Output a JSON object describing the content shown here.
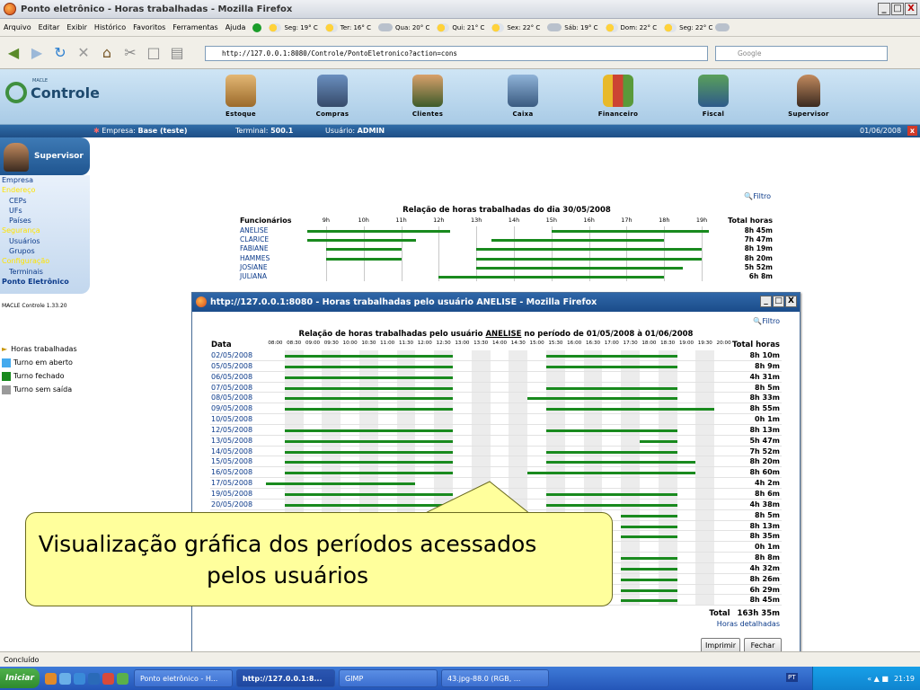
{
  "browser": {
    "title": "Ponto eletrônico - Horas trabalhadas - Mozilla Firefox",
    "window_buttons": [
      "_",
      "□",
      "X"
    ],
    "menu": [
      "Arquivo",
      "Editar",
      "Exibir",
      "Histórico",
      "Favoritos",
      "Ferramentas",
      "Ajuda"
    ],
    "weather": [
      "Seg: 19° C",
      "Ter: 16° C",
      "Qua: 20° C",
      "Qui: 21° C",
      "Sex: 22° C",
      "Sáb: 19° C",
      "Dom: 22° C",
      "Seg: 22° C"
    ],
    "url": "http://127.0.0.1:8080/Controle/PontoEletronico?action=cons",
    "search_placeholder": "Google",
    "status": "Concluído"
  },
  "app": {
    "logo_small": "MACLE",
    "logo": "Controle",
    "modules": [
      "Estoque",
      "Compras",
      "Clientes",
      "Caixa",
      "Financeiro",
      "Fiscal",
      "Supervisor"
    ],
    "status_strip": {
      "empresa_label": "Empresa:",
      "empresa": "Base (teste)",
      "terminal_label": "Terminal:",
      "terminal": "500.1",
      "usuario_label": "Usuário:",
      "usuario": "ADMIN",
      "date": "01/06/2008"
    }
  },
  "sidebar": {
    "user_box": "Supervisor",
    "nav": [
      {
        "label": "Empresa",
        "style": "h"
      },
      {
        "label": "Endereço",
        "style": "y"
      },
      {
        "label": "CEPs",
        "style": "s"
      },
      {
        "label": "UFs",
        "style": "s"
      },
      {
        "label": "Países",
        "style": "s"
      },
      {
        "label": "Segurança",
        "style": "y"
      },
      {
        "label": "Usuários",
        "style": "s"
      },
      {
        "label": "Grupos",
        "style": "s"
      },
      {
        "label": "Configuração",
        "style": "y"
      },
      {
        "label": "Terminais",
        "style": "s"
      },
      {
        "label": "Ponto Eletrônico",
        "style": "b"
      }
    ],
    "version": "MACLE Controle 1.33.20",
    "legend": [
      {
        "label": "Horas trabalhadas",
        "color": ""
      },
      {
        "label": "Turno em aberto",
        "color": "#44aaee"
      },
      {
        "label": "Turno fechado",
        "color": "#198a1e"
      },
      {
        "label": "Turno sem saída",
        "color": "#9a9a9a"
      }
    ]
  },
  "bg_report": {
    "filtro": "Filtro",
    "title": "Relação de horas trabalhadas do dia 30/05/2008",
    "col_name": "Funcionários",
    "col_total": "Total horas",
    "hours": [
      "9h",
      "10h",
      "11h",
      "12h",
      "13h",
      "14h",
      "15h",
      "16h",
      "17h",
      "18h",
      "19h"
    ],
    "rows": [
      {
        "name": "ANELISE",
        "total": "8h 45m"
      },
      {
        "name": "CLARICE",
        "total": "7h 47m"
      },
      {
        "name": "FABIANE",
        "total": "8h 19m"
      },
      {
        "name": "HAMMES",
        "total": "8h 20m"
      },
      {
        "name": "JOSIANE",
        "total": "5h 52m"
      },
      {
        "name": "JULIANA",
        "total": "6h 8m"
      }
    ]
  },
  "popup": {
    "title": "http://127.0.0.1:8080 - Horas trabalhadas pelo usuário ANELISE - Mozilla Firefox",
    "filtro": "Filtro",
    "chart_title_pre": "Relação de horas trabalhadas pelo usuário ",
    "chart_title_user": "ANELISE",
    "chart_title_post": " no período de 01/05/2008 à 01/06/2008",
    "col_date": "Data",
    "col_total": "Total horas",
    "times": [
      "08:00",
      "08:30",
      "09:00",
      "09:30",
      "10:00",
      "10:30",
      "11:00",
      "11:30",
      "12:00",
      "12:30",
      "13:00",
      "13:30",
      "14:00",
      "14:30",
      "15:00",
      "15:30",
      "16:00",
      "16:30",
      "17:00",
      "17:30",
      "18:00",
      "18:30",
      "19:00",
      "19:30",
      "20:00"
    ],
    "rows": [
      {
        "date": "02/05/2008",
        "total": "8h 10m"
      },
      {
        "date": "05/05/2008",
        "total": "8h 9m"
      },
      {
        "date": "06/05/2008",
        "total": "4h 31m"
      },
      {
        "date": "07/05/2008",
        "total": "8h 5m"
      },
      {
        "date": "08/05/2008",
        "total": "8h 33m"
      },
      {
        "date": "09/05/2008",
        "total": "8h 55m"
      },
      {
        "date": "10/05/2008",
        "total": "0h 1m"
      },
      {
        "date": "12/05/2008",
        "total": "8h 13m"
      },
      {
        "date": "13/05/2008",
        "total": "5h 47m"
      },
      {
        "date": "14/05/2008",
        "total": "7h 52m"
      },
      {
        "date": "15/05/2008",
        "total": "8h 20m"
      },
      {
        "date": "16/05/2008",
        "total": "8h 60m"
      },
      {
        "date": "17/05/2008",
        "total": "4h 2m"
      },
      {
        "date": "19/05/2008",
        "total": "8h 6m"
      },
      {
        "date": "20/05/2008",
        "total": "4h 38m"
      },
      {
        "date": "",
        "total": "8h 5m"
      },
      {
        "date": "",
        "total": "8h 13m"
      },
      {
        "date": "",
        "total": "8h 35m"
      },
      {
        "date": "",
        "total": "0h 1m"
      },
      {
        "date": "",
        "total": "8h 8m"
      },
      {
        "date": "",
        "total": "4h 32m"
      },
      {
        "date": "",
        "total": "8h 26m"
      },
      {
        "date": "",
        "total": "6h 29m"
      },
      {
        "date": "",
        "total": "8h 45m"
      }
    ],
    "total_label": "Total",
    "total_value": "163h 35m",
    "detail_link": "Horas detalhadas",
    "btn_print": "Imprimir",
    "btn_close": "Fechar"
  },
  "callout": {
    "text": "Visualização gráfica dos períodos acessados pelos usuários"
  },
  "taskbar": {
    "start": "Iniciar",
    "tasks": [
      "Ponto eletrônico - H...",
      "http://127.0.0.1:8...",
      "GIMP",
      "43.jpg-88.0 (RGB, ..."
    ],
    "lang": "PT",
    "clock": "21:19"
  },
  "chart_data": [
    {
      "type": "gantt",
      "title": "Relação de horas trabalhadas do dia 30/05/2008",
      "x_unit": "hour",
      "xlim": [
        8.5,
        19.5
      ],
      "categories": [
        "ANELISE",
        "CLARICE",
        "FABIANE",
        "HAMMES",
        "JOSIANE",
        "JULIANA"
      ],
      "segments": [
        [
          [
            8.5,
            12.3
          ],
          [
            15.0,
            19.2
          ]
        ],
        [
          [
            8.5,
            11.4
          ],
          [
            13.4,
            18.0
          ]
        ],
        [
          [
            9.0,
            11.0
          ],
          [
            13.0,
            19.0
          ]
        ],
        [
          [
            9.0,
            11.0
          ],
          [
            13.0,
            19.0
          ]
        ],
        [
          [
            13.0,
            18.5
          ]
        ],
        [
          [
            12.0,
            18.0
          ]
        ]
      ],
      "totals": [
        "8h 45m",
        "7h 47m",
        "8h 19m",
        "8h 20m",
        "5h 52m",
        "6h 8m"
      ]
    },
    {
      "type": "gantt",
      "title": "Relação de horas trabalhadas pelo usuário ANELISE no período de 01/05/2008 à 01/06/2008",
      "x_unit": "hour",
      "xlim": [
        8.0,
        20.5
      ],
      "categories": [
        "02/05/2008",
        "05/05/2008",
        "06/05/2008",
        "07/05/2008",
        "08/05/2008",
        "09/05/2008",
        "10/05/2008",
        "12/05/2008",
        "13/05/2008",
        "14/05/2008",
        "15/05/2008",
        "16/05/2008",
        "17/05/2008",
        "19/05/2008",
        "20/05/2008",
        "",
        "",
        "",
        "",
        "",
        "",
        "",
        "",
        ""
      ],
      "segments": [
        [
          [
            8.5,
            13.0
          ],
          [
            15.5,
            19.0
          ]
        ],
        [
          [
            8.5,
            13.0
          ],
          [
            15.5,
            19.0
          ]
        ],
        [
          [
            8.5,
            13.0
          ]
        ],
        [
          [
            8.5,
            13.0
          ],
          [
            15.5,
            19.0
          ]
        ],
        [
          [
            8.5,
            13.0
          ],
          [
            15.0,
            19.0
          ]
        ],
        [
          [
            8.5,
            13.0
          ],
          [
            15.5,
            20.0
          ]
        ],
        [],
        [
          [
            8.5,
            13.0
          ],
          [
            15.5,
            19.0
          ]
        ],
        [
          [
            8.5,
            13.0
          ],
          [
            18.0,
            19.0
          ]
        ],
        [
          [
            8.5,
            13.0
          ],
          [
            15.5,
            19.0
          ]
        ],
        [
          [
            8.5,
            13.0
          ],
          [
            15.5,
            19.5
          ]
        ],
        [
          [
            8.5,
            13.0
          ],
          [
            15.0,
            19.5
          ]
        ],
        [
          [
            8.0,
            12.0
          ]
        ],
        [
          [
            8.5,
            13.0
          ],
          [
            15.5,
            19.0
          ]
        ],
        [
          [
            8.5,
            13.0
          ],
          [
            15.5,
            19.0
          ]
        ],
        [
          [
            17.5,
            19.0
          ]
        ],
        [
          [
            17.5,
            19.0
          ]
        ],
        [
          [
            17.5,
            19.0
          ]
        ],
        [],
        [
          [
            17.5,
            19.0
          ]
        ],
        [
          [
            17.5,
            19.0
          ]
        ],
        [
          [
            17.5,
            19.0
          ]
        ],
        [
          [
            17.5,
            19.0
          ]
        ],
        [
          [
            17.5,
            19.0
          ]
        ]
      ],
      "totals": [
        "8h 10m",
        "8h 9m",
        "4h 31m",
        "8h 5m",
        "8h 33m",
        "8h 55m",
        "0h 1m",
        "8h 13m",
        "5h 47m",
        "7h 52m",
        "8h 20m",
        "8h 60m",
        "4h 2m",
        "8h 6m",
        "4h 38m",
        "8h 5m",
        "8h 13m",
        "8h 35m",
        "0h 1m",
        "8h 8m",
        "4h 32m",
        "8h 26m",
        "6h 29m",
        "8h 45m"
      ],
      "total": "163h 35m"
    }
  ]
}
